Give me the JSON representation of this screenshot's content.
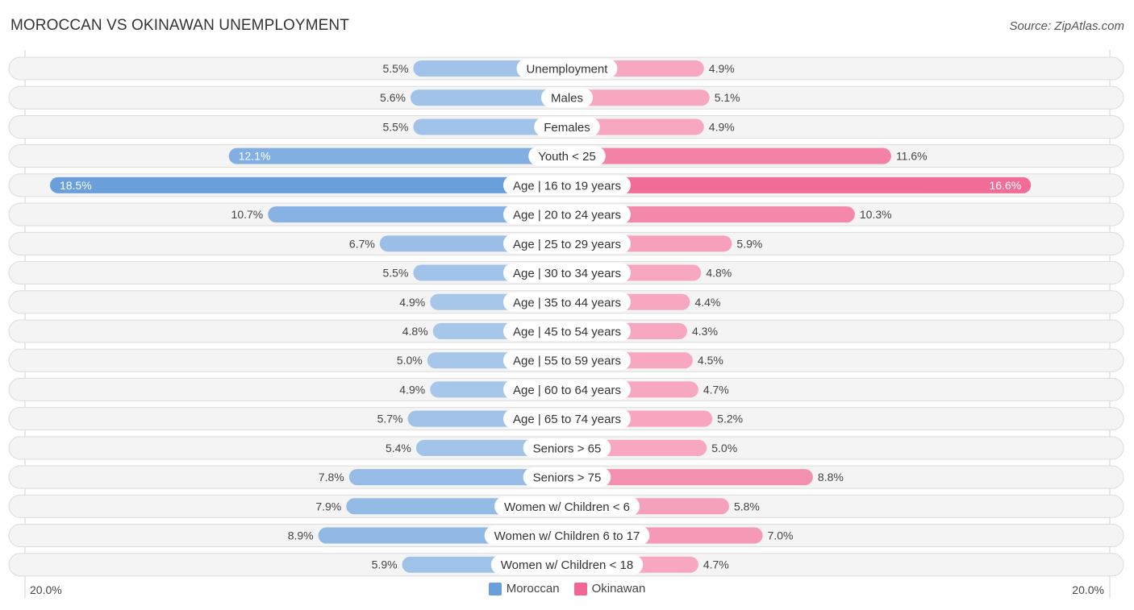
{
  "header": {
    "title": "MOROCCAN VS OKINAWAN UNEMPLOYMENT",
    "source": "Source: ZipAtlas.com"
  },
  "legend": {
    "items": [
      {
        "name": "Moroccan",
        "color": "#6a9fdc"
      },
      {
        "name": "Okinawan",
        "color": "#f06592"
      }
    ]
  },
  "axis": {
    "left_label": "20.0%",
    "right_label": "20.0%"
  },
  "chart_data": {
    "type": "bar",
    "orientation": "horizontal-diverging",
    "title": "MOROCCAN VS OKINAWAN UNEMPLOYMENT",
    "xlabel": "",
    "ylabel": "",
    "xlim": [
      -20,
      20
    ],
    "unit": "%",
    "legend_position": "bottom-center",
    "categories": [
      "Unemployment",
      "Males",
      "Females",
      "Youth < 25",
      "Age | 16 to 19 years",
      "Age | 20 to 24 years",
      "Age | 25 to 29 years",
      "Age | 30 to 34 years",
      "Age | 35 to 44 years",
      "Age | 45 to 54 years",
      "Age | 55 to 59 years",
      "Age | 60 to 64 years",
      "Age | 65 to 74 years",
      "Seniors > 65",
      "Seniors > 75",
      "Women w/ Children < 6",
      "Women w/ Children 6 to 17",
      "Women w/ Children < 18"
    ],
    "series": [
      {
        "name": "Moroccan",
        "side": "left",
        "color_light": "#a6c6ea",
        "color_strong": "#6a9fdc",
        "values": [
          5.5,
          5.6,
          5.5,
          12.1,
          18.5,
          10.7,
          6.7,
          5.5,
          4.9,
          4.8,
          5.0,
          4.9,
          5.7,
          5.4,
          7.8,
          7.9,
          8.9,
          5.9
        ]
      },
      {
        "name": "Okinawan",
        "side": "right",
        "color_light": "#f7a8c0",
        "color_strong": "#f06592",
        "values": [
          4.9,
          5.1,
          4.9,
          11.6,
          16.6,
          10.3,
          5.9,
          4.8,
          4.4,
          4.3,
          4.5,
          4.7,
          5.2,
          5.0,
          8.8,
          5.8,
          7.0,
          4.7
        ]
      }
    ]
  }
}
